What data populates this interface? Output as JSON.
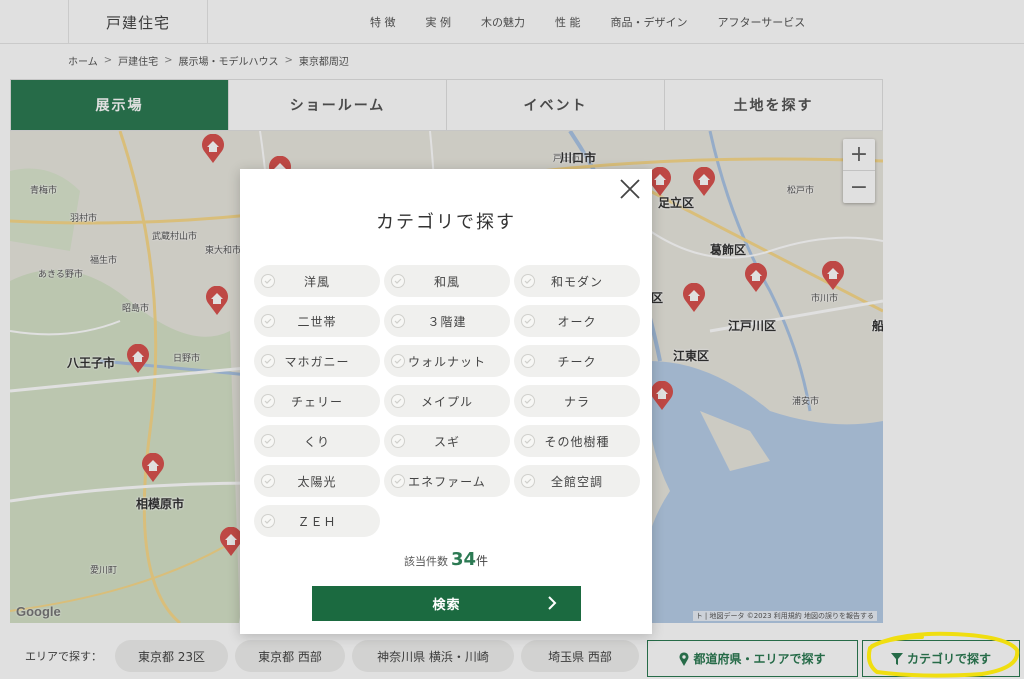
{
  "header": {
    "brand": "戸建住宅",
    "nav": [
      "特 徴",
      "実 例",
      "木の魅力",
      "性 能",
      "商品・デザイン",
      "アフターサービス"
    ]
  },
  "breadcrumb": [
    "ホーム",
    "戸建住宅",
    "展示場・モデルハウス",
    "東京都周辺"
  ],
  "breadcrumb_sep": ">",
  "tabs": [
    "展示場",
    "ショールーム",
    "イベント",
    "土地を探す"
  ],
  "map": {
    "labels": {
      "kawaguchi": "川口市",
      "toda": "戸田市",
      "adachi": "足立区",
      "katsushika": "葛飾区",
      "edogawa": "江戸川区",
      "koto": "江東区",
      "ichikawa": "市川市",
      "hachioji": "八王子市",
      "sagamihara": "相模原市",
      "hamura": "羽村市",
      "musashimurayama": "武蔵村山市",
      "higashiyamato": "東大和市",
      "akishima": "昭島市",
      "hino": "日野市",
      "akiruno": "あきる野市",
      "ome": "青梅市",
      "fussa": "福生市",
      "matsudo": "松戸市",
      "urayasu": "浦安市",
      "ku": "区",
      "funa": "船",
      "aikawa": "愛川町"
    },
    "zoom_in": "+",
    "zoom_out": "−",
    "google": "Google",
    "attribution": "ト | 地図データ ©2023 利用規約 地図の誤りを報告する"
  },
  "area_bar": {
    "label": "エリアで探す：",
    "chips": [
      "東京都 23区",
      "東京都 西部",
      "神奈川県 横浜・川崎",
      "埼玉県 西部"
    ],
    "prefecture_button": "都道府県・エリアで探す",
    "category_button": "カテゴリで探す"
  },
  "modal": {
    "title": "カテゴリで探す",
    "categories": [
      "洋風",
      "和風",
      "和モダン",
      "二世帯",
      "３階建",
      "オーク",
      "マホガニー",
      "ウォルナット",
      "チーク",
      "チェリー",
      "メイプル",
      "ナラ",
      "くり",
      "スギ",
      "その他樹種",
      "太陽光",
      "エネファーム",
      "全館空調",
      "ＺＥＨ"
    ],
    "count_label": "該当件数",
    "count_value": "34",
    "count_unit": "件",
    "search_button": "検索"
  },
  "colors": {
    "accent_green": "#2c7a53",
    "search_green": "#1b6a40",
    "pin_red": "#d9534f",
    "highlight_yellow": "#f5e31a"
  }
}
